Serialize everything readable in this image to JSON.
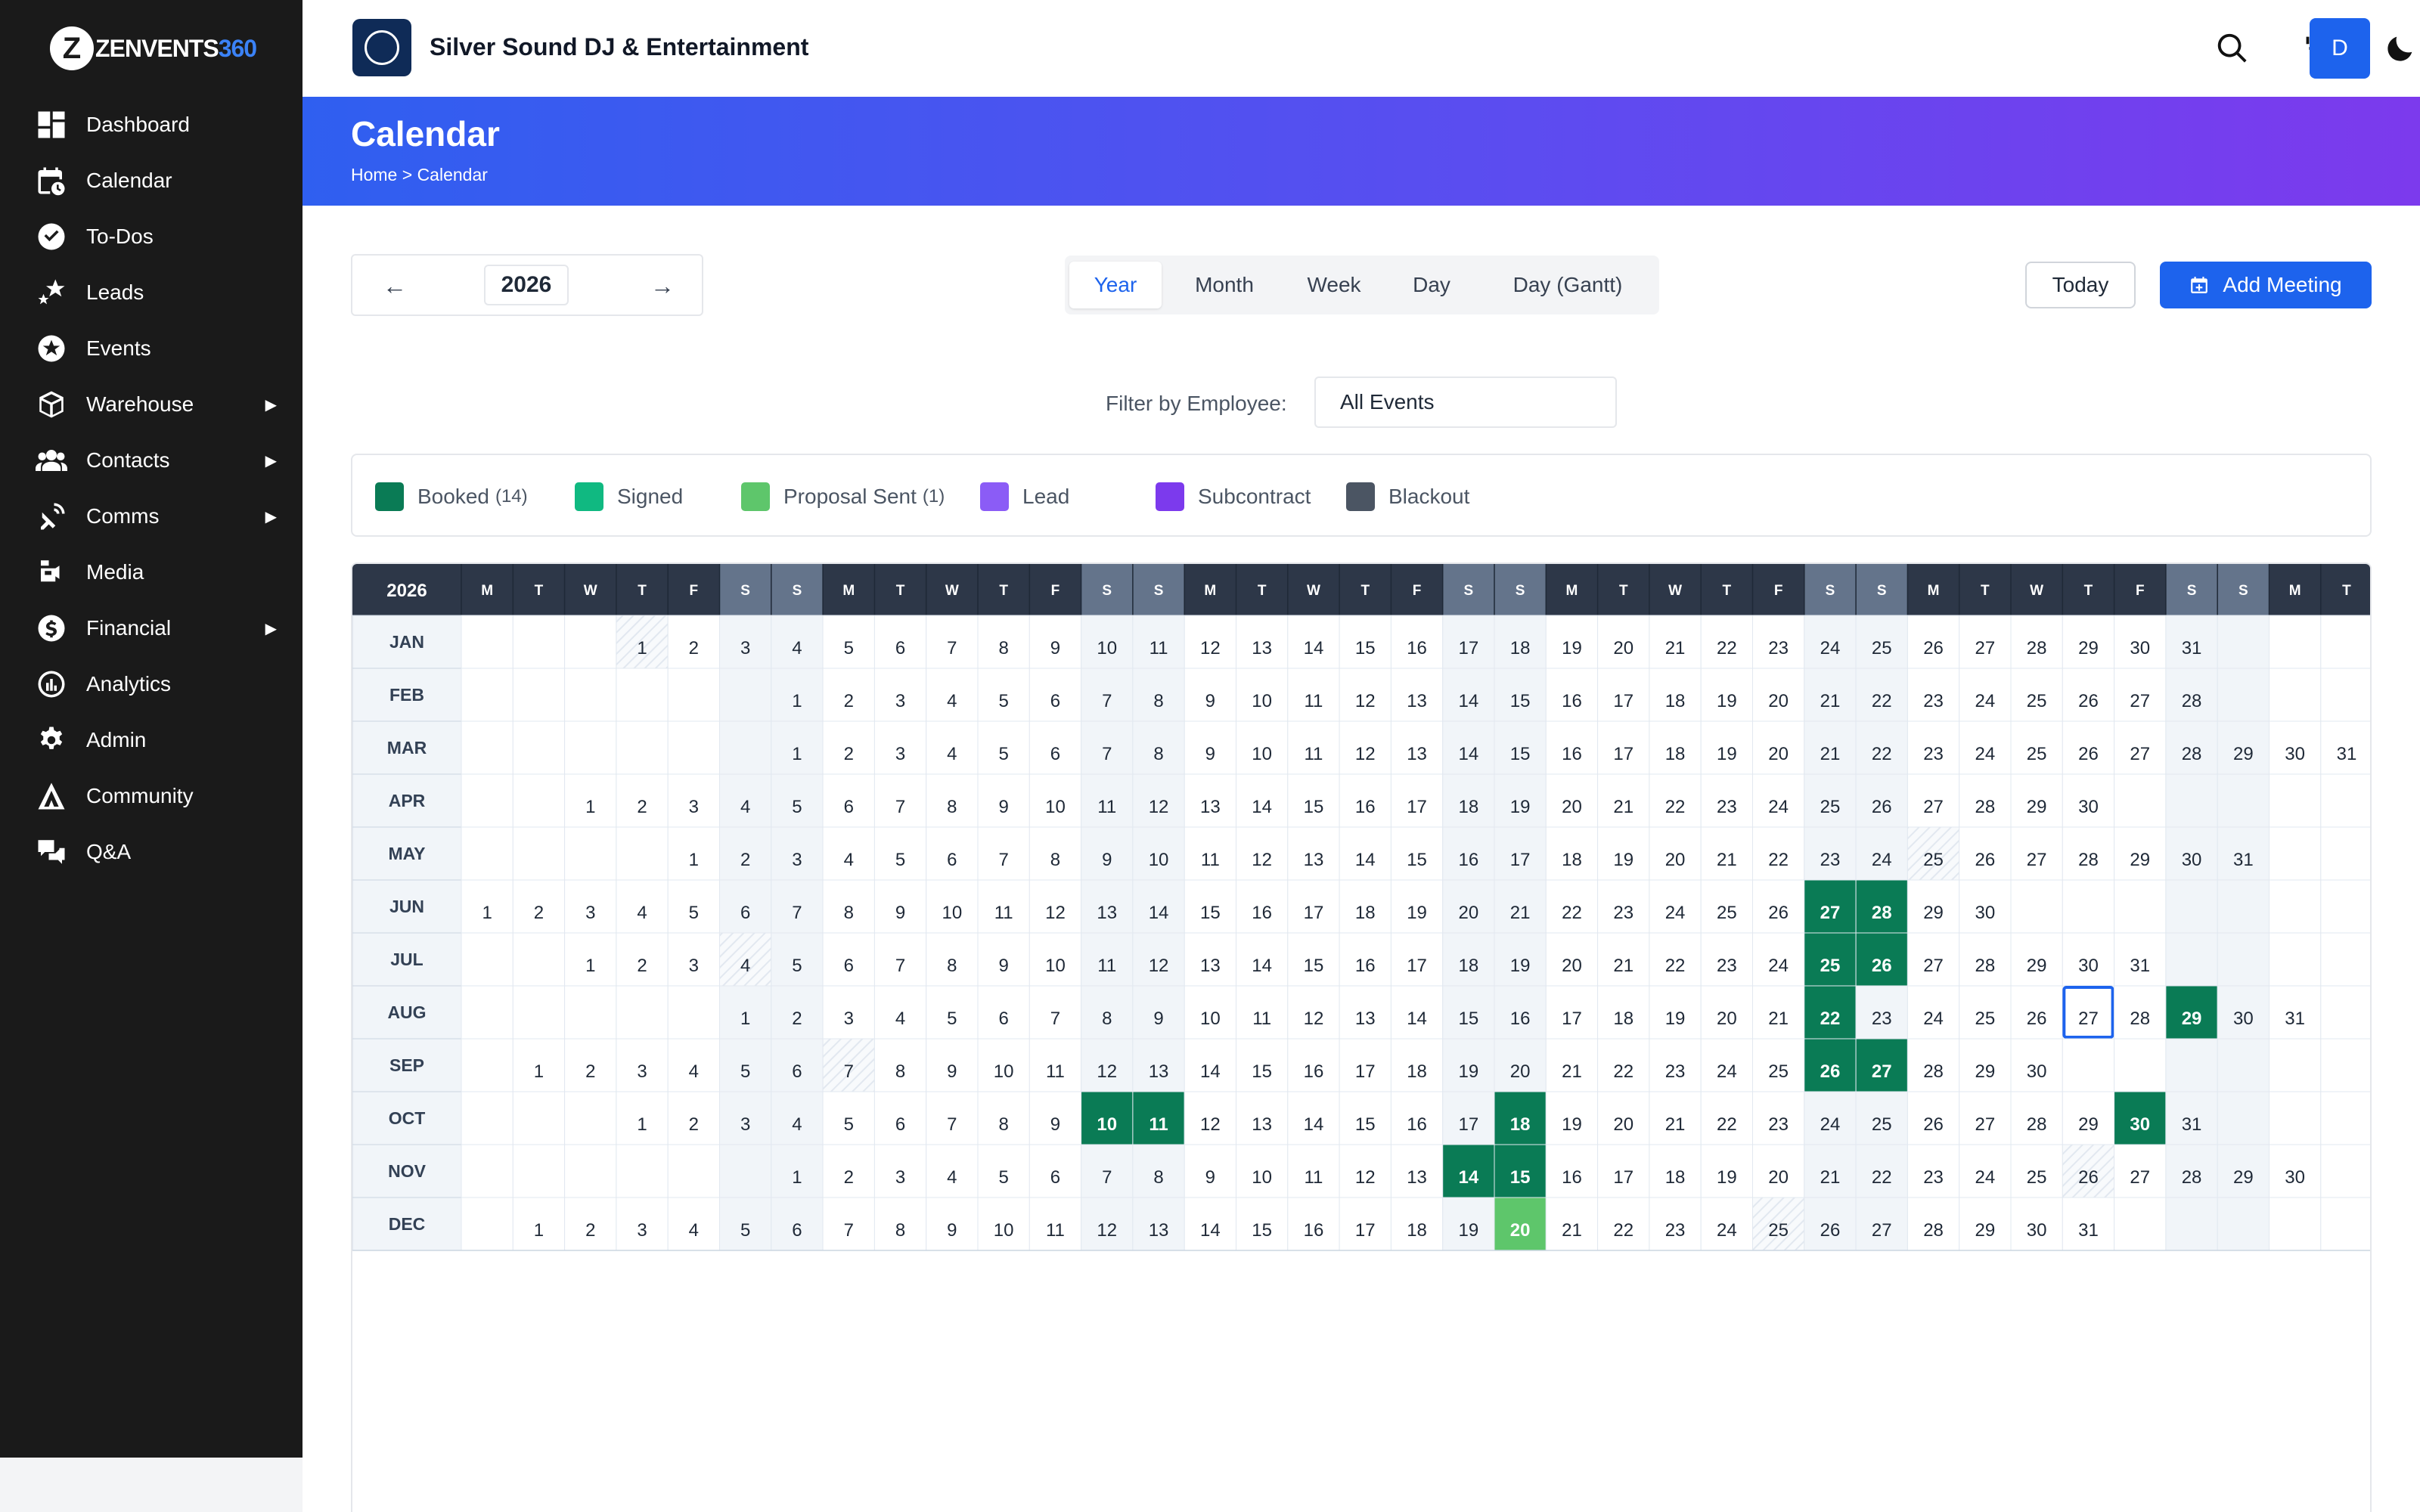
{
  "brand": {
    "letter": "Z",
    "name": "ZENVENTS",
    "num": "360"
  },
  "sidebar": {
    "items": [
      {
        "label": "Dashboard",
        "icon": "dashboard-icon",
        "arrow": false
      },
      {
        "label": "Calendar",
        "icon": "calendar-icon",
        "arrow": false
      },
      {
        "label": "To-Dos",
        "icon": "check-circle-icon",
        "arrow": false
      },
      {
        "label": "Leads",
        "icon": "stars-icon",
        "arrow": false
      },
      {
        "label": "Events",
        "icon": "star-circle-icon",
        "arrow": false
      },
      {
        "label": "Warehouse",
        "icon": "box-icon",
        "arrow": true
      },
      {
        "label": "Contacts",
        "icon": "users-icon",
        "arrow": true
      },
      {
        "label": "Comms",
        "icon": "satellite-icon",
        "arrow": true
      },
      {
        "label": "Media",
        "icon": "camera-icon",
        "arrow": false
      },
      {
        "label": "Financial",
        "icon": "dollar-icon",
        "arrow": true
      },
      {
        "label": "Analytics",
        "icon": "chart-icon",
        "arrow": false
      },
      {
        "label": "Admin",
        "icon": "gear-icon",
        "arrow": false
      },
      {
        "label": "Community",
        "icon": "tent-icon",
        "arrow": false
      },
      {
        "label": "Q&A",
        "icon": "qa-icon",
        "arrow": false
      }
    ],
    "arrow_glyph": "▶"
  },
  "topbar": {
    "business_name": "Silver Sound DJ & Entertainment",
    "avatar_initial": "D"
  },
  "header": {
    "title": "Calendar",
    "breadcrumb": "Home > Calendar"
  },
  "toolbar": {
    "prev": "←",
    "next": "→",
    "year": "2026",
    "views": [
      "Year",
      "Month",
      "Week",
      "Day",
      "Day (Gantt)"
    ],
    "active_view": "Year",
    "today_label": "Today",
    "add_meeting_label": "Add Meeting"
  },
  "filter": {
    "label": "Filter by Employee:",
    "value": "All Events"
  },
  "legend": [
    {
      "label": "Booked",
      "count": "(14)",
      "color": "#0a7b55"
    },
    {
      "label": "Signed",
      "count": "",
      "color": "#10b981"
    },
    {
      "label": "Proposal Sent",
      "count": "(1)",
      "color": "#5ec66b"
    },
    {
      "label": "Lead",
      "count": "",
      "color": "#8b5cf6"
    },
    {
      "label": "Subcontract",
      "count": "",
      "color": "#7c3aed"
    },
    {
      "label": "Blackout",
      "count": "",
      "color": "#4b5563"
    }
  ],
  "calendar": {
    "year": "2026",
    "weekday_headers": [
      "M",
      "T",
      "W",
      "T",
      "F",
      "S",
      "S",
      "M",
      "T",
      "W",
      "T",
      "F",
      "S",
      "S",
      "M",
      "T",
      "W",
      "T",
      "F",
      "S",
      "S",
      "M",
      "T",
      "W",
      "T",
      "F",
      "S",
      "S",
      "M",
      "T",
      "W",
      "T",
      "F",
      "S",
      "S",
      "M",
      "T"
    ],
    "months": [
      {
        "name": "JAN",
        "offset": 3,
        "days": 31
      },
      {
        "name": "FEB",
        "offset": 6,
        "days": 28
      },
      {
        "name": "MAR",
        "offset": 6,
        "days": 31
      },
      {
        "name": "APR",
        "offset": 2,
        "days": 30
      },
      {
        "name": "MAY",
        "offset": 4,
        "days": 31
      },
      {
        "name": "JUN",
        "offset": 0,
        "days": 30
      },
      {
        "name": "JUL",
        "offset": 2,
        "days": 31
      },
      {
        "name": "AUG",
        "offset": 5,
        "days": 31
      },
      {
        "name": "SEP",
        "offset": 1,
        "days": 30
      },
      {
        "name": "OCT",
        "offset": 3,
        "days": 31
      },
      {
        "name": "NOV",
        "offset": 6,
        "days": 30
      },
      {
        "name": "DEC",
        "offset": 1,
        "days": 31
      }
    ],
    "booked": [
      {
        "month": "JUN",
        "days": [
          27,
          28
        ]
      },
      {
        "month": "JUL",
        "days": [
          25,
          26
        ]
      },
      {
        "month": "AUG",
        "days": [
          22,
          29
        ]
      },
      {
        "month": "SEP",
        "days": [
          26,
          27
        ]
      },
      {
        "month": "OCT",
        "days": [
          10,
          11,
          18,
          30
        ]
      },
      {
        "month": "NOV",
        "days": [
          14,
          15
        ]
      }
    ],
    "proposal_sent": [
      {
        "month": "DEC",
        "days": [
          20
        ]
      }
    ],
    "holidays": [
      {
        "month": "JAN",
        "days": [
          1
        ]
      },
      {
        "month": "MAY",
        "days": [
          25
        ]
      },
      {
        "month": "JUL",
        "days": [
          4
        ]
      },
      {
        "month": "SEP",
        "days": [
          7
        ]
      },
      {
        "month": "NOV",
        "days": [
          26
        ]
      },
      {
        "month": "DEC",
        "days": [
          25
        ]
      }
    ],
    "today": {
      "month": "AUG",
      "day": 27
    },
    "colors": {
      "header_bg": "#2d3748",
      "weekend_header_bg": "#64748b",
      "weekend_cell_bg": "#f1f5f9",
      "booked": "#0a7b55",
      "proposal_sent": "#5ec66b",
      "today_border": "#1d63ed"
    }
  }
}
